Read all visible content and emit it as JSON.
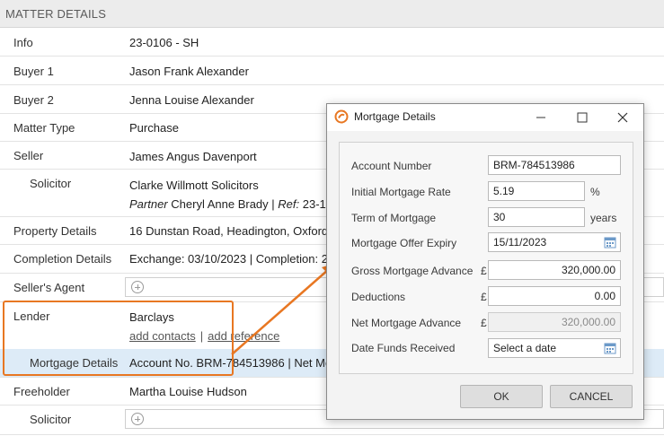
{
  "section": {
    "title": "MATTER DETAILS"
  },
  "rows": {
    "info": {
      "label": "Info",
      "value": "23-0106 - SH"
    },
    "buyer1": {
      "label": "Buyer 1",
      "value": "Jason Frank Alexander"
    },
    "buyer2": {
      "label": "Buyer 2",
      "value": "Jenna Louise Alexander"
    },
    "matter_type": {
      "label": "Matter Type",
      "value": "Purchase"
    },
    "seller": {
      "label": "Seller",
      "value": "James Angus Davenport"
    },
    "seller_solicitor": {
      "label": "Solicitor",
      "value": "Clarke Willmott Solicitors",
      "partner_label": "Partner",
      "partner_name": "Cheryl Anne Brady",
      "ref_label": "Ref:",
      "ref_value": "23-10"
    },
    "property_details": {
      "label": "Property Details",
      "value": "16 Dunstan Road, Headington, Oxford,"
    },
    "completion_details": {
      "label": "Completion Details",
      "value": "Exchange: 03/10/2023 | Completion: 2"
    },
    "sellers_agent": {
      "label": "Seller's Agent"
    },
    "lender": {
      "label": "Lender",
      "value": "Barclays",
      "add_contacts": "add contacts",
      "separator": "|",
      "add_reference": "add reference"
    },
    "mortgage_details": {
      "label": "Mortgage Details",
      "value": "Account No. BRM-784513986 | Net Mo"
    },
    "freeholder": {
      "label": "Freeholder",
      "value": "Martha Louise Hudson"
    },
    "freeholder_solicitor": {
      "label": "Solicitor"
    }
  },
  "dialog": {
    "title": "Mortgage Details",
    "fields": {
      "account_number": {
        "label": "Account Number",
        "value": "BRM-784513986"
      },
      "initial_rate": {
        "label": "Initial Mortgage Rate",
        "value": "5.19",
        "unit": "%"
      },
      "term": {
        "label": "Term of Mortgage",
        "value": "30",
        "unit": "years"
      },
      "offer_expiry": {
        "label": "Mortgage Offer Expiry",
        "value": "15/11/2023"
      },
      "gross_advance": {
        "label": "Gross Mortgage Advance",
        "currency": "£",
        "value": "320,000.00"
      },
      "deductions": {
        "label": "Deductions",
        "currency": "£",
        "value": "0.00"
      },
      "net_advance": {
        "label": "Net Mortgage Advance",
        "currency": "£",
        "value": "320,000.00"
      },
      "funds_received": {
        "label": "Date Funds Received",
        "placeholder": "Select a date"
      }
    },
    "buttons": {
      "ok": "OK",
      "cancel": "CANCEL"
    }
  },
  "colors": {
    "accent": "#e87722",
    "highlight": "#ddebf7"
  }
}
